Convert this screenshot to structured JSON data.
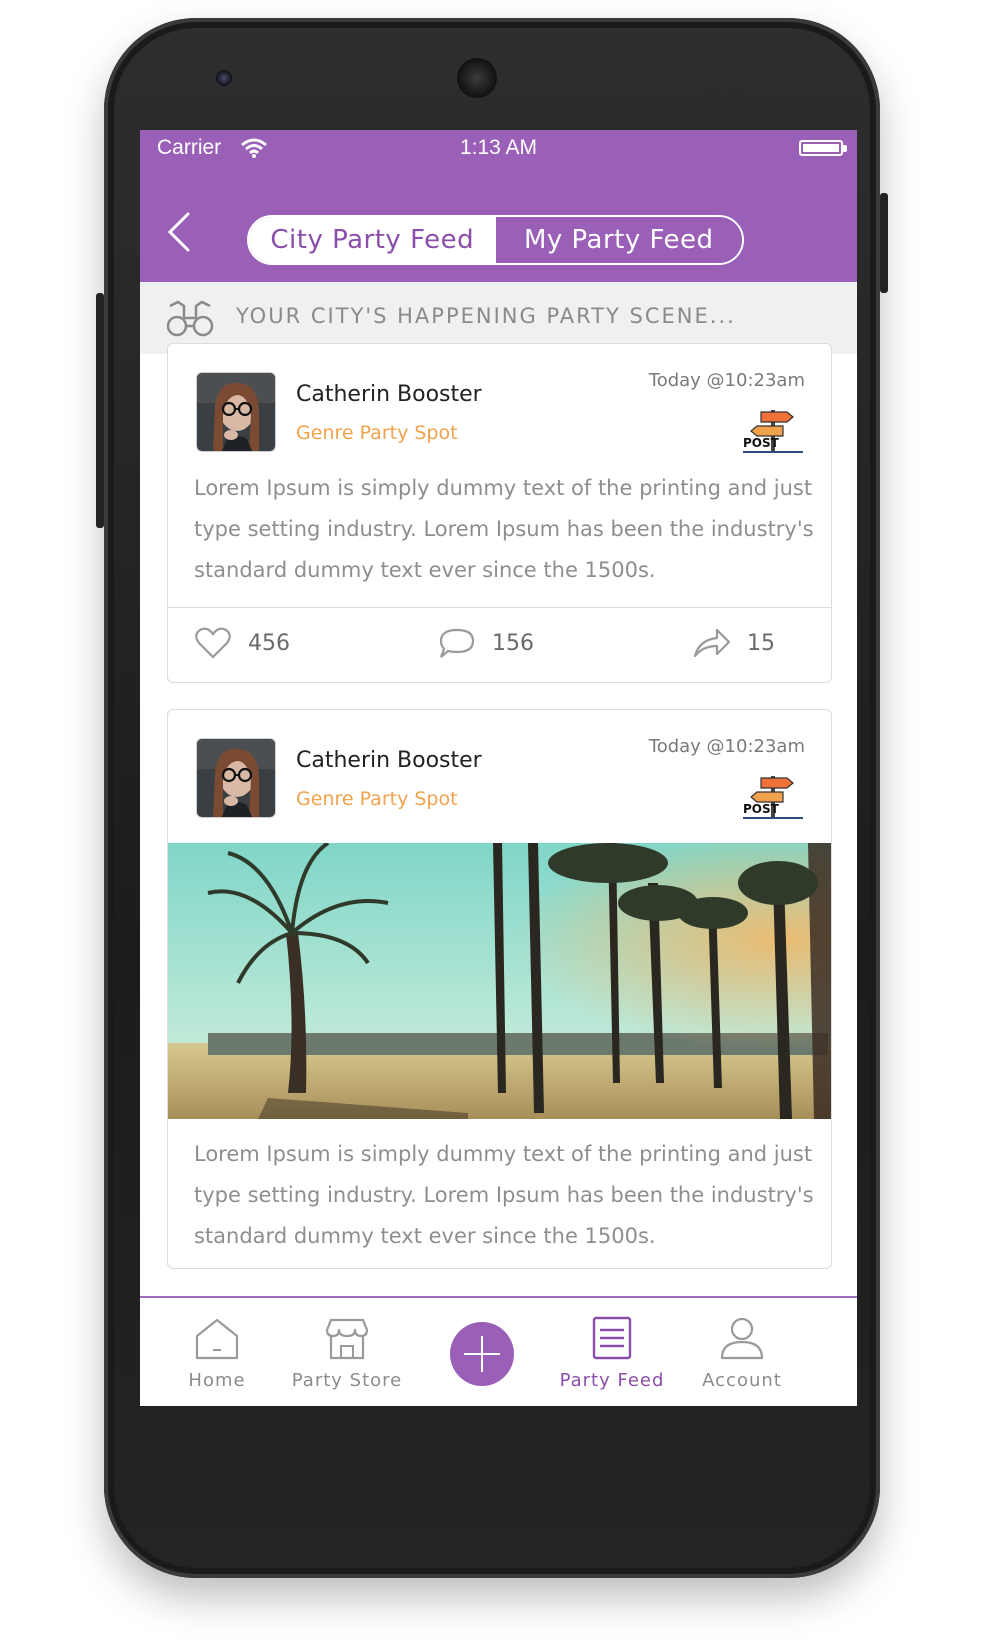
{
  "status_bar": {
    "carrier": "Carrier",
    "time": "1:13 AM"
  },
  "nav": {
    "tabs": [
      {
        "label": "City Party Feed",
        "active": true
      },
      {
        "label": "My Party Feed",
        "active": false
      }
    ]
  },
  "subheader": {
    "text": "YOUR CITY'S HAPPENING PARTY SCENE...",
    "icon": "binoculars-icon"
  },
  "posts": [
    {
      "author": "Catherin Booster",
      "genre": "Genre Party Spot",
      "timestamp": "Today @10:23am",
      "badge_text": "POST",
      "body": "Lorem Ipsum is simply dummy text of the printing and just type setting industry. Lorem Ipsum has been the industry's standard dummy text ever since the 1500s.",
      "likes": "456",
      "comments": "156",
      "shares": "15"
    },
    {
      "author": "Catherin Booster",
      "genre": "Genre Party Spot",
      "timestamp": "Today @10:23am",
      "badge_text": "POST",
      "body": "Lorem Ipsum is simply dummy text of the printing and just type setting industry. Lorem Ipsum has been the industry's standard dummy text ever since the 1500s."
    }
  ],
  "tabbar": {
    "items": [
      {
        "label": "Home",
        "icon": "home-icon"
      },
      {
        "label": "Party Store",
        "icon": "store-icon"
      },
      {
        "label": "Party Feed",
        "icon": "feed-icon",
        "active": true
      },
      {
        "label": "Account",
        "icon": "account-icon"
      }
    ]
  },
  "colors": {
    "primary": "#9a5fb7",
    "accent": "#f0a24c"
  }
}
